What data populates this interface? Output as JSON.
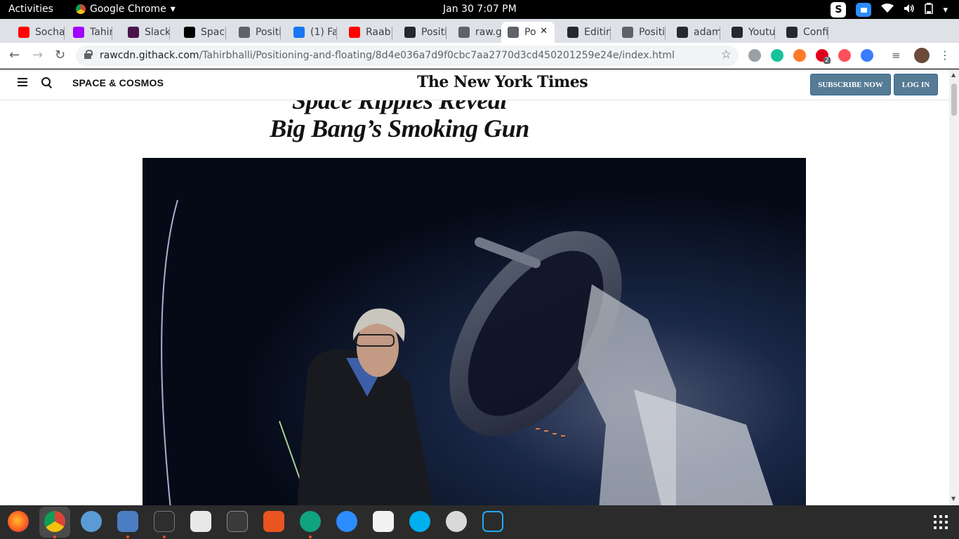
{
  "system_bar": {
    "activities": "Activities",
    "app_name": "Google Chrome",
    "datetime": "Jan 30   7:07 PM"
  },
  "tabs": [
    {
      "label": "Socha",
      "color": "#ff0000"
    },
    {
      "label": "Tahir'",
      "color": "#a100ff"
    },
    {
      "label": "Slack",
      "color": "#4a154b"
    },
    {
      "label": "Space",
      "color": "#000000"
    },
    {
      "label": "Positi",
      "color": "#5f6368"
    },
    {
      "label": "(1) Fa",
      "color": "#1877f2"
    },
    {
      "label": "Raab",
      "color": "#ff0000"
    },
    {
      "label": "Positi",
      "color": "#24292e"
    },
    {
      "label": "raw.g",
      "color": "#5f6368"
    },
    {
      "label": "Po",
      "color": "#5f6368",
      "active": true
    },
    {
      "label": "Editin",
      "color": "#24292e"
    },
    {
      "label": "Positi",
      "color": "#5f6368"
    },
    {
      "label": "adam",
      "color": "#24292e"
    },
    {
      "label": "Youtu",
      "color": "#24292e"
    },
    {
      "label": "Confi",
      "color": "#24292e"
    }
  ],
  "address_bar": {
    "host": "rawcdn.githack.com",
    "path": "/Tahirbhalli/Positioning-and-floating/8d4e036a7d9f0cbc7aa2770d3cd450201259e24e/index.html"
  },
  "extensions": {
    "badge_count": "2"
  },
  "page": {
    "section_label": "SPACE & COSMOS",
    "logo": "The New York Times",
    "subscribe_label": "SUBSCRIBE NOW",
    "login_label": "LOG IN",
    "headline_line1": "Space Ripples Reveal",
    "headline_line2": "Big Bang’s Smoking Gun"
  },
  "colors": {
    "nyt_button": "#567b95",
    "tab_strip": "#dee1e6",
    "dock": "#2b2b2b"
  }
}
